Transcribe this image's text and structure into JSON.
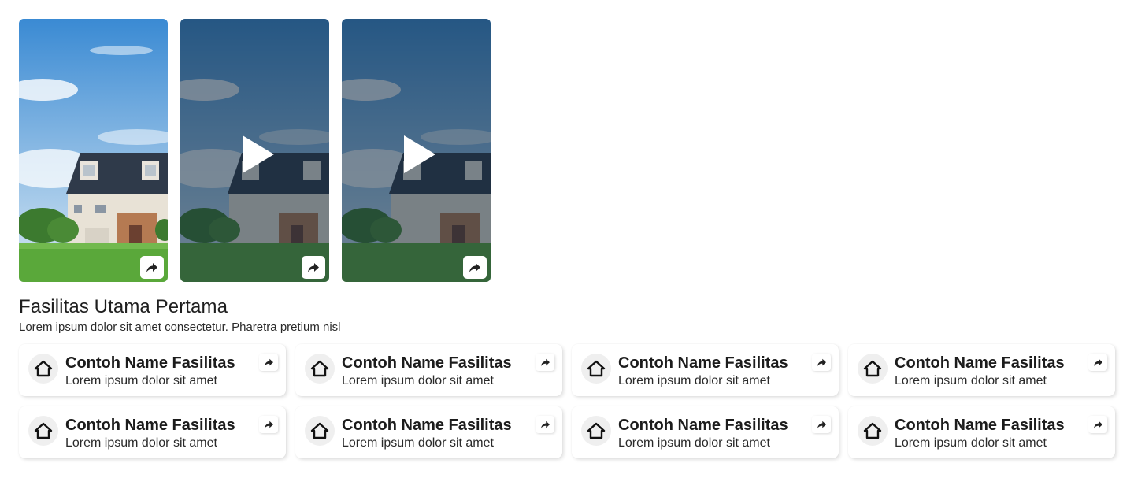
{
  "gallery": {
    "items": [
      {
        "kind": "image",
        "share_icon": "share-icon"
      },
      {
        "kind": "video",
        "play_icon": "play-icon",
        "share_icon": "share-icon"
      },
      {
        "kind": "video",
        "play_icon": "play-icon",
        "share_icon": "share-icon"
      }
    ]
  },
  "section": {
    "title": "Fasilitas Utama Pertama",
    "description": "Lorem ipsum dolor sit amet consectetur. Pharetra pretium nisl"
  },
  "facilities": [
    {
      "name": "Contoh Name Fasilitas",
      "desc": "Lorem ipsum dolor sit amet",
      "icon": "home-icon"
    },
    {
      "name": "Contoh Name Fasilitas",
      "desc": "Lorem ipsum dolor sit amet",
      "icon": "home-icon"
    },
    {
      "name": "Contoh Name Fasilitas",
      "desc": "Lorem ipsum dolor sit amet",
      "icon": "home-icon"
    },
    {
      "name": "Contoh Name Fasilitas",
      "desc": "Lorem ipsum dolor sit amet",
      "icon": "home-icon"
    },
    {
      "name": "Contoh Name Fasilitas",
      "desc": "Lorem ipsum dolor sit amet",
      "icon": "home-icon"
    },
    {
      "name": "Contoh Name Fasilitas",
      "desc": "Lorem ipsum dolor sit amet",
      "icon": "home-icon"
    },
    {
      "name": "Contoh Name Fasilitas",
      "desc": "Lorem ipsum dolor sit amet",
      "icon": "home-icon"
    },
    {
      "name": "Contoh Name Fasilitas",
      "desc": "Lorem ipsum dolor sit amet",
      "icon": "home-icon"
    }
  ],
  "colors": {
    "sky_top": "#3f8fd6",
    "sky_bottom": "#cfe3f3",
    "grass": "#5aa83a",
    "roof": "#2f3a4a",
    "video_overlay": "#14283c"
  }
}
